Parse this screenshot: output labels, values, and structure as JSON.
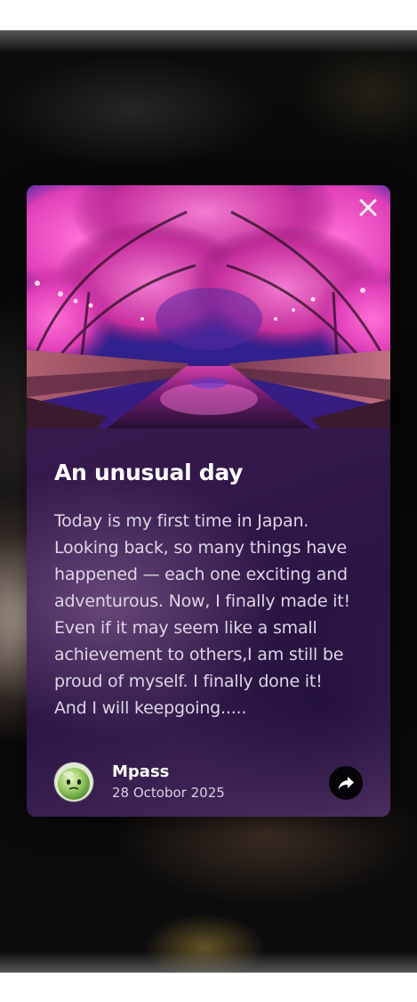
{
  "post": {
    "title": "An unusual day",
    "story_lines": [
      "Today is my first time in Japan.",
      "Looking back, so many things have",
      "happened — each one exciting and",
      "adventurous. Now, I finally made it!",
      "Even if it may seem like a small",
      "achievement to others,I am still be",
      "proud of myself. I finally done it!",
      "And I will keepgoing....."
    ],
    "author": {
      "name": "Mpass",
      "date": "28 Octobor 2025"
    }
  },
  "icons": {
    "close": "close-icon",
    "share": "share-arrow-icon",
    "avatar": "green-robot-avatar"
  },
  "colors": {
    "card_background": "#35194d",
    "title": "#ffffff",
    "body_text": "#ddd6e6",
    "share_button": "#050308"
  }
}
